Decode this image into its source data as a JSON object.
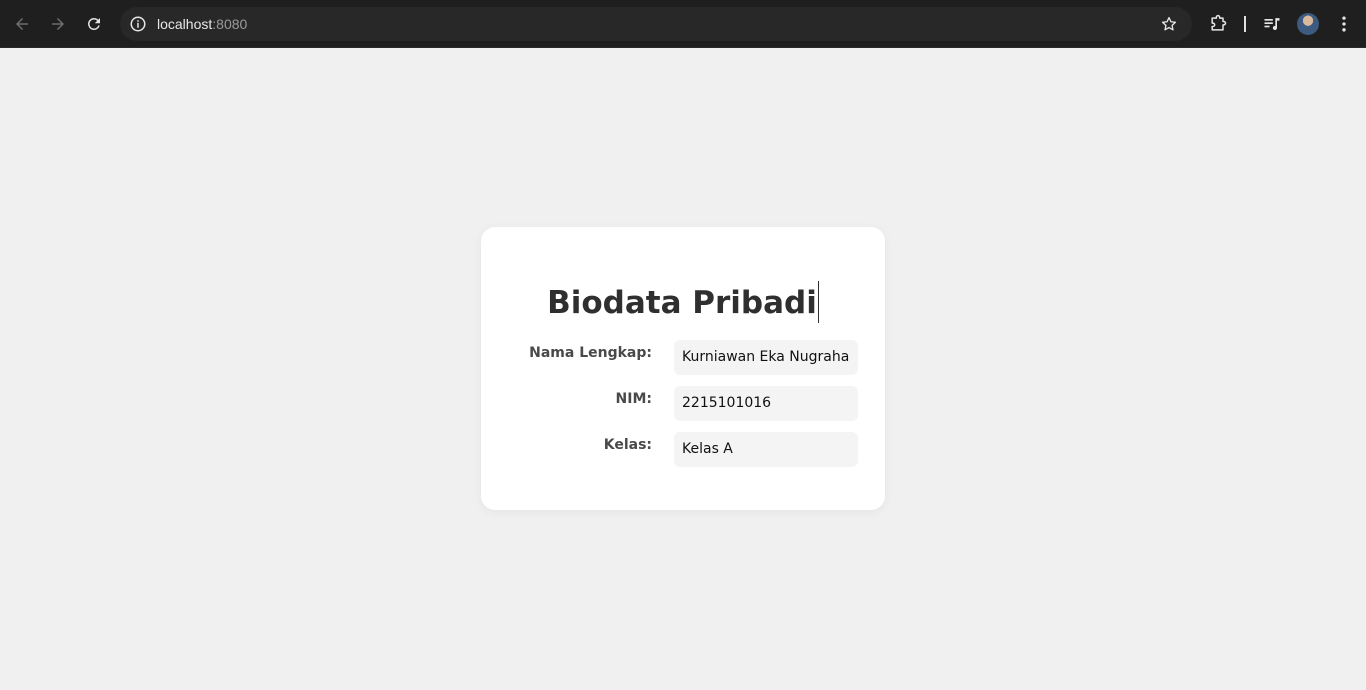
{
  "browser": {
    "url_host": "localhost",
    "url_port": ":8080",
    "icons": [
      "back-arrow-icon",
      "forward-arrow-icon",
      "reload-icon",
      "info-icon",
      "star-icon",
      "extensions-icon",
      "media-control-icon",
      "avatar",
      "kebab-menu-icon"
    ]
  },
  "card": {
    "title": "Biodata Pribadi",
    "fields": [
      {
        "label": "Nama Lengkap:",
        "value": "Kurniawan Eka Nugraha"
      },
      {
        "label": "NIM:",
        "value": "2215101016"
      },
      {
        "label": "Kelas:",
        "value": "Kelas A"
      }
    ]
  },
  "colors": {
    "page_background": "#f0f0f0",
    "card_background": "#ffffff",
    "browser_bar": "#1f1f1f",
    "field_background": "#f4f4f4"
  }
}
